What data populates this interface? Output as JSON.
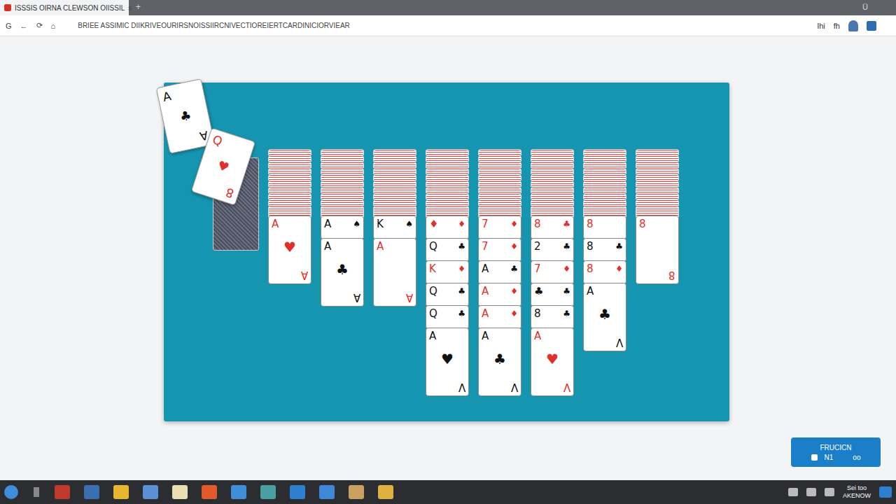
{
  "browser": {
    "tab_title": "ISSSIS OIRNA CLEWSON OIISSIL",
    "tab_close": "s",
    "new_tab": "+",
    "menu": "Ü",
    "nav": [
      "G",
      "←",
      "⟳",
      "⌂"
    ],
    "url": "BRIEE ASSIMIC DIIKRIVEOURIRSNOISSIIRCNIVECTIOREIERTCARDINICIORVIEAR",
    "toolbar": [
      "Ihi",
      "fh"
    ]
  },
  "tossed_cards": [
    {
      "rank": "A",
      "suit": "♣",
      "corner": "A",
      "color": "#111111"
    },
    {
      "rank": "Q",
      "suit": "♥",
      "corner": "8",
      "color": "#e0302c"
    }
  ],
  "columns": [
    {
      "hidden": 10,
      "cards": [
        {
          "rank": "A",
          "suit": "♥",
          "color": "#e0302c",
          "corner": "A"
        }
      ]
    },
    {
      "hidden": 10,
      "cards": [
        {
          "rank": "A",
          "suit": "♠",
          "color": "#111111"
        },
        {
          "rank": "A",
          "suit": "♣",
          "color": "#111111",
          "corner": "A"
        }
      ]
    },
    {
      "hidden": 10,
      "cards": [
        {
          "rank": "K",
          "suit": "♠",
          "color": "#111111"
        },
        {
          "rank": "A",
          "color": "#e0302c",
          "corner": "A"
        }
      ]
    },
    {
      "hidden": 10,
      "cards": [
        {
          "rank": "♦",
          "suit": "♦",
          "color": "#e0302c"
        },
        {
          "rank": "Q",
          "suit": "♣",
          "color": "#111111"
        },
        {
          "rank": "K",
          "suit": "♦",
          "color": "#e0302c"
        },
        {
          "rank": "Q",
          "suit": "♣",
          "color": "#111111"
        },
        {
          "rank": "Q",
          "suit": "♣",
          "color": "#111111"
        },
        {
          "rank": "A",
          "suit": "♥",
          "color": "#111111",
          "corner": "V"
        }
      ]
    },
    {
      "hidden": 10,
      "cards": [
        {
          "rank": "7",
          "suit": "♦",
          "color": "#e0302c"
        },
        {
          "rank": "7",
          "suit": "♦",
          "color": "#e0302c"
        },
        {
          "rank": "A",
          "suit": "♣",
          "color": "#111111"
        },
        {
          "rank": "A",
          "suit": "♦",
          "color": "#e0302c"
        },
        {
          "rank": "A",
          "suit": "♦",
          "color": "#e0302c"
        },
        {
          "rank": "A",
          "suit": "♣",
          "color": "#111111",
          "corner": "V"
        }
      ]
    },
    {
      "hidden": 10,
      "cards": [
        {
          "rank": "8",
          "suit": "♣",
          "color": "#e0302c"
        },
        {
          "rank": "2",
          "suit": "♣",
          "color": "#111111"
        },
        {
          "rank": "7",
          "suit": "♦",
          "color": "#e0302c"
        },
        {
          "rank": "♣",
          "suit": "♣",
          "color": "#111111"
        },
        {
          "rank": "8",
          "suit": "♣",
          "color": "#111111"
        },
        {
          "rank": "A",
          "suit": "♥",
          "color": "#e0302c",
          "corner": "V"
        }
      ]
    },
    {
      "hidden": 10,
      "cards": [
        {
          "rank": "8",
          "color": "#e0302c"
        },
        {
          "rank": "8",
          "suit": "♣",
          "color": "#111111"
        },
        {
          "rank": "8",
          "suit": "♦",
          "color": "#e0302c"
        },
        {
          "rank": "A",
          "suit": "♣",
          "color": "#111111",
          "corner": "V"
        }
      ]
    },
    {
      "hidden": 10,
      "cards": [
        {
          "rank": "8",
          "color": "#e0302c",
          "corner": "8"
        }
      ]
    }
  ],
  "float_button": {
    "title": "FRUCICN",
    "count": "N1",
    "extra": "oo"
  },
  "taskbar": {
    "clock_time": "Sei too",
    "clock_date": "AKENOW"
  }
}
